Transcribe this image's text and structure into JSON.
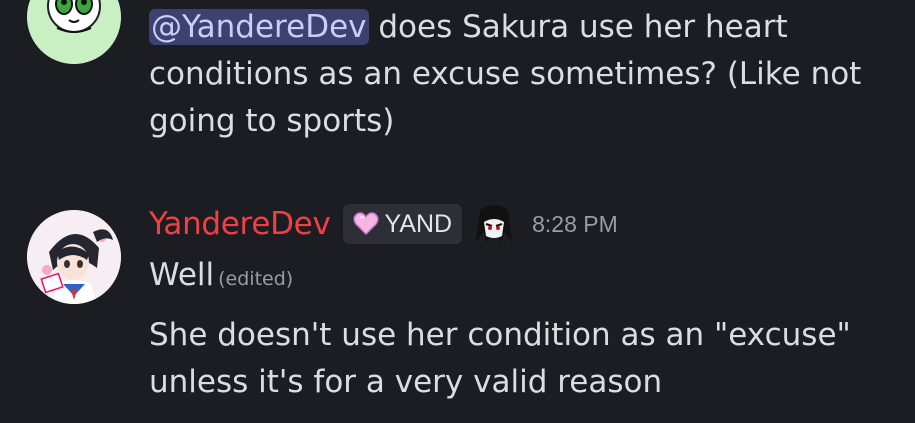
{
  "message_1": {
    "mention": "@YandereDev",
    "text_after_mention": " does Sakura use her heart conditions as an excuse sometimes? (Like not going to sports)"
  },
  "message_2": {
    "author": "YandereDev",
    "role_tag": "YAND",
    "timestamp": "8:28 PM",
    "line_1": "Well",
    "edited_label": "(edited)",
    "line_2": "She doesn't use her condition as an \"excuse\" unless it's for a very valid reason"
  },
  "colors": {
    "background": "#1c1d23",
    "author_name": "#f23f43",
    "mention_bg": "#3c4170",
    "body_text": "#dbdee1",
    "muted_text": "#9a9ca3"
  },
  "icons": {
    "avatar_1": "powerpuff-avatar",
    "avatar_2": "anime-girl-avatar",
    "role_tag_icon": "pink-heart-icon",
    "role_icon": "anime-face-icon"
  }
}
